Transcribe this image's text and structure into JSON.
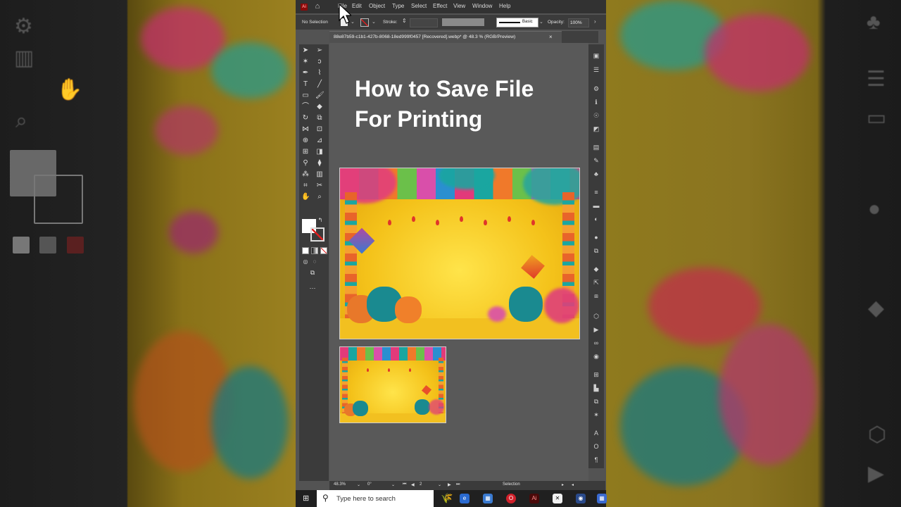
{
  "menubar": {
    "logo": "Ai",
    "items": [
      "File",
      "Edit",
      "Object",
      "Type",
      "Select",
      "Effect",
      "View",
      "Window",
      "Help"
    ]
  },
  "control_bar": {
    "selection": "No Selection",
    "stroke_label": "Stroke:",
    "brush": "Basic",
    "opacity_label": "Opacity:",
    "opacity_value": "100%"
  },
  "document_tab": {
    "title": "88e87b59-c1b1-427b-8068-18ed999f0457 [Recovered].webp* @ 48.3 % (RGB/Preview)",
    "close": "×"
  },
  "canvas": {
    "headline_line1": "How to Save File",
    "headline_line2": "For Printing"
  },
  "statusbar": {
    "zoom": "48.3%",
    "rotation": "0°",
    "artboard": "2",
    "tool": "Selection"
  },
  "taskbar": {
    "search_placeholder": "Type here to search"
  },
  "colors": {
    "app_bg": "#535353",
    "panel": "#3b3b3b",
    "menubar": "#323232",
    "artwork_yellow": "#f4c21a",
    "ai_logo": "#8a0a0a"
  }
}
